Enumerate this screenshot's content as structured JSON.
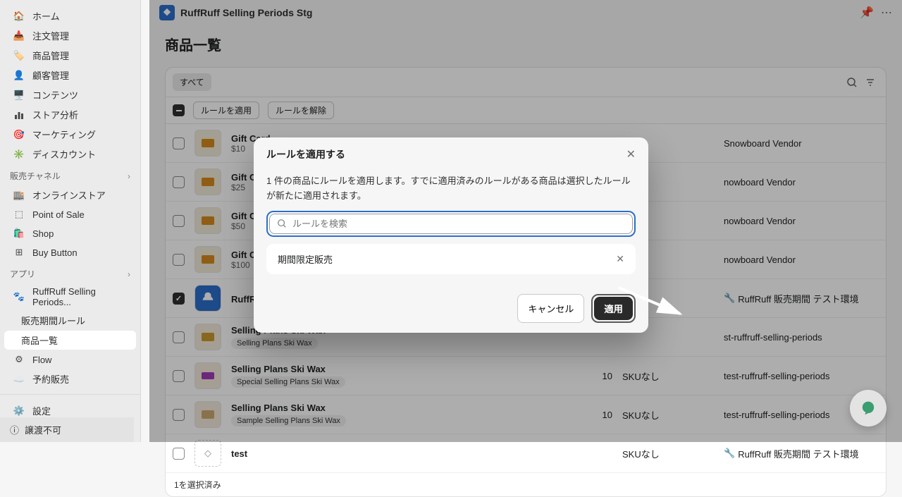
{
  "sidebar": {
    "nav": [
      {
        "icon": "home",
        "label": "ホーム"
      },
      {
        "icon": "inbox",
        "label": "注文管理"
      },
      {
        "icon": "tag",
        "label": "商品管理"
      },
      {
        "icon": "user",
        "label": "顧客管理"
      },
      {
        "icon": "layout",
        "label": "コンテンツ"
      },
      {
        "icon": "chart",
        "label": "ストア分析"
      },
      {
        "icon": "target",
        "label": "マーケティング"
      },
      {
        "icon": "discount",
        "label": "ディスカウント"
      }
    ],
    "channels_header": "販売チャネル",
    "channels": [
      {
        "icon": "store",
        "label": "オンラインストア"
      },
      {
        "icon": "pos",
        "label": "Point of Sale"
      },
      {
        "icon": "shop",
        "label": "Shop"
      },
      {
        "icon": "buy",
        "label": "Buy Button"
      }
    ],
    "apps_header": "アプリ",
    "apps": [
      {
        "icon": "ruff",
        "label": "RuffRuff Selling Periods...",
        "sub": [
          {
            "label": "販売期間ルール"
          },
          {
            "label": "商品一覧",
            "active": true
          }
        ]
      },
      {
        "icon": "flow",
        "label": "Flow"
      },
      {
        "icon": "cloud",
        "label": "予約販売"
      }
    ],
    "settings": "設定",
    "banner": "譲渡不可"
  },
  "topbar": {
    "app_name": "RuffRuff Selling Periods Stg"
  },
  "page_title": "商品一覧",
  "tabs": {
    "all": "すべて"
  },
  "bulk": {
    "apply": "ルールを適用",
    "remove": "ルールを解除"
  },
  "products": [
    {
      "name": "Gift Card",
      "sub": "$10",
      "thumb": "orange",
      "vendor": "Snowboard Vendor",
      "checked": false
    },
    {
      "name": "Gift Card",
      "sub": "$25",
      "thumb": "orange",
      "vendor": "nowboard Vendor",
      "checked": false
    },
    {
      "name": "Gift Card",
      "sub": "$50",
      "thumb": "orange",
      "vendor": "nowboard Vendor",
      "checked": false
    },
    {
      "name": "Gift Card",
      "sub": "$100",
      "thumb": "orange",
      "vendor": "nowboard Vendor",
      "checked": false
    },
    {
      "name": "RuffRuff デモ商品",
      "sub": "",
      "thumb": "blue",
      "vendor": "RuffRuff 販売期間 テスト環境",
      "checked": true,
      "tool": true
    },
    {
      "name": "Selling Plans Ski Wax",
      "tag": "Selling Plans Ski Wax",
      "thumb": "yellow",
      "vendor": "st-ruffruff-selling-periods",
      "checked": false
    },
    {
      "name": "Selling Plans Ski Wax",
      "tag": "Special Selling Plans Ski Wax",
      "thumb": "purple",
      "inv": "10",
      "sku": "SKUなし",
      "vendor": "test-ruffruff-selling-periods",
      "checked": false
    },
    {
      "name": "Selling Plans Ski Wax",
      "tag": "Sample Selling Plans Ski Wax",
      "thumb": "tan",
      "inv": "10",
      "sku": "SKUなし",
      "vendor": "test-ruffruff-selling-periods",
      "checked": false
    },
    {
      "name": "test",
      "sub": "",
      "thumb": "dashed",
      "sku": "SKUなし",
      "vendor": "RuffRuff 販売期間 テスト環境",
      "tool": true,
      "checked": false
    }
  ],
  "footer": "1を選択済み",
  "modal": {
    "title": "ルールを適用する",
    "body": "1 件の商品にルールを適用します。すでに適用済みのルールがある商品は選択したルールが新たに適用されます。",
    "placeholder": "ルールを検索",
    "option": "期間限定販売",
    "cancel": "キャンセル",
    "apply": "適用"
  }
}
